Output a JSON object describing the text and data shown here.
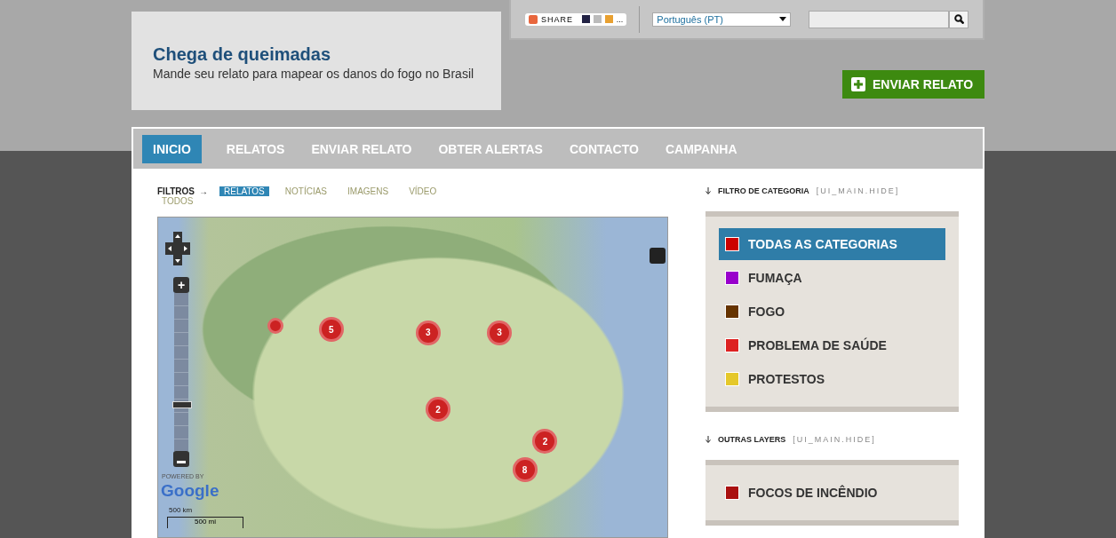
{
  "header": {
    "title": "Chega de queimadas",
    "subtitle": "Mande seu relato para mapear os danos do fogo no Brasil"
  },
  "toolbar": {
    "share": {
      "label": "SHARE",
      "more": "..."
    },
    "language": {
      "value": "Português (PT)"
    }
  },
  "cta_button": {
    "label": "ENVIAR RELATO"
  },
  "nav": [
    {
      "label": "INICIO",
      "selected": true
    },
    {
      "label": "RELATOS",
      "selected": false
    },
    {
      "label": "ENVIAR RELATO",
      "selected": false
    },
    {
      "label": "OBTER ALERTAS",
      "selected": false
    },
    {
      "label": "CONTACTO",
      "selected": false
    },
    {
      "label": "CAMPANHA",
      "selected": false
    }
  ],
  "filters": {
    "label": "FILTROS",
    "arrow": "→",
    "items": [
      {
        "label": "RELATOS",
        "selected": true
      },
      {
        "label": "NOTÍCIAS",
        "selected": false
      },
      {
        "label": "IMAGENS",
        "selected": false
      },
      {
        "label": "VÍDEO",
        "selected": false
      },
      {
        "label": "TODOS",
        "selected": false
      }
    ]
  },
  "map": {
    "markers": [
      {
        "kind": "single"
      },
      {
        "kind": "cluster",
        "count": "5"
      },
      {
        "kind": "cluster",
        "count": "3"
      },
      {
        "kind": "cluster",
        "count": "3"
      },
      {
        "kind": "cluster",
        "count": "2"
      },
      {
        "kind": "cluster",
        "count": "2"
      },
      {
        "kind": "cluster",
        "count": "8"
      }
    ],
    "zoom_in": "+",
    "zoom": {
      "level": 0.3
    },
    "attribution": "POWERED BY",
    "logo": "Google",
    "scale_km": "500 km",
    "scale_mi": "500 mi"
  },
  "category_filter": {
    "title": "FILTRO DE CATEGORIA",
    "toggle": "[UI_MAIN.HIDE]",
    "items": [
      {
        "label": "TODAS AS CATEGORIAS",
        "color": "#cc0000",
        "selected": true
      },
      {
        "label": "FUMAÇA",
        "color": "#9900cc",
        "selected": false
      },
      {
        "label": "FOGO",
        "color": "#663300",
        "selected": false
      },
      {
        "label": "PROBLEMA DE SAÚDE",
        "color": "#dd2222",
        "selected": false
      },
      {
        "label": "PROTESTOS",
        "color": "#e5c82a",
        "selected": false
      }
    ]
  },
  "other_layers": {
    "title": "OUTRAS LAYERS",
    "toggle": "[UI_MAIN.HIDE]",
    "items": [
      {
        "label": "FOCOS DE INCÊNDIO",
        "color": "#aa1111",
        "selected": false
      }
    ]
  }
}
